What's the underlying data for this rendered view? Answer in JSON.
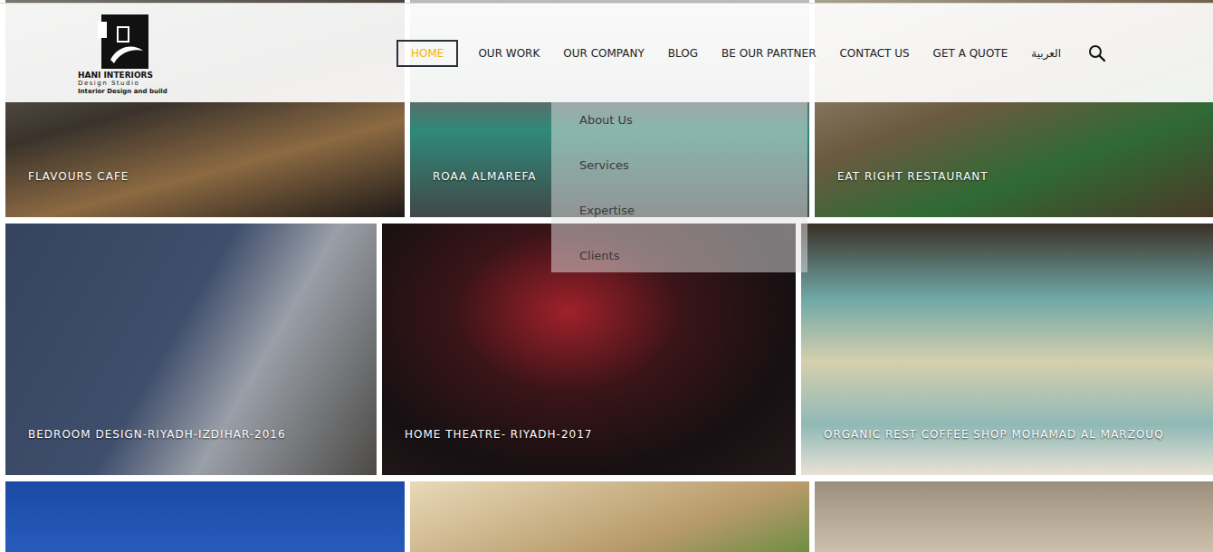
{
  "logo": {
    "name": "HANI INTERIORS",
    "tagline": "Design Studio",
    "subtitle": "Interior Design and build"
  },
  "nav": [
    {
      "label": "HOME",
      "selected": true
    },
    {
      "label": "OUR WORK",
      "selected": false
    },
    {
      "label": "OUR COMPANY",
      "selected": false
    },
    {
      "label": "BLOG",
      "selected": false
    },
    {
      "label": "BE OUR PARTNER",
      "selected": false
    },
    {
      "label": "CONTACT US",
      "selected": false
    },
    {
      "label": "GET A QUOTE",
      "selected": false
    },
    {
      "label": "العربية",
      "selected": false
    }
  ],
  "dropdown": {
    "items": [
      "About Us",
      "Services",
      "Expertise",
      "Clients"
    ]
  },
  "rows": [
    {
      "tiles": [
        {
          "label": "FLAVOURS CAFE"
        },
        {
          "label": "ROAA ALMAREFA"
        },
        {
          "label": "EAT RIGHT RESTAURANT"
        }
      ]
    },
    {
      "tiles": [
        {
          "label": "BEDROOM DESIGN-RIYADH-IZDIHAR-2016"
        },
        {
          "label": "HOME THEATRE- RIYADH-2017"
        },
        {
          "label": "ORGANIC REST COFFEE SHOP MOHAMAD AL MARZOUQ"
        }
      ]
    },
    {
      "tiles": [
        {
          "label": ""
        },
        {
          "label": ""
        },
        {
          "label": ""
        }
      ]
    }
  ]
}
